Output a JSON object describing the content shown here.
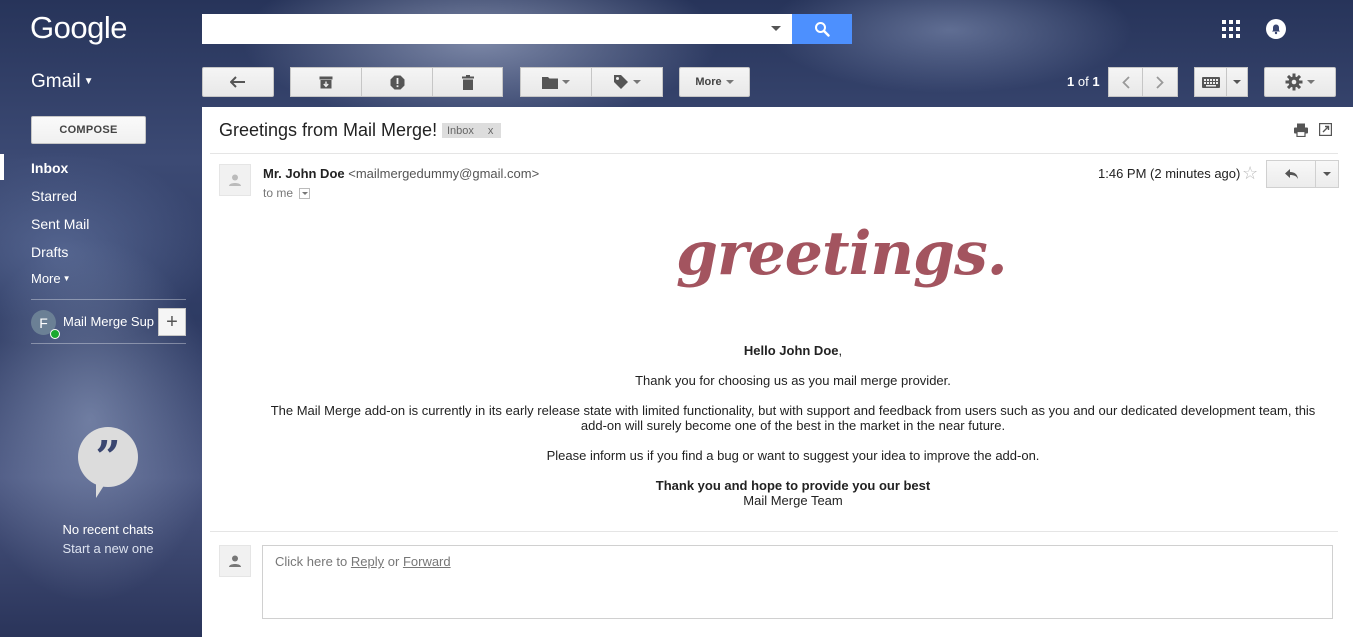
{
  "brand": {
    "logo_text": "Google",
    "app_name": "Gmail"
  },
  "search": {
    "value": "",
    "placeholder": ""
  },
  "toolbar": {
    "more_label": "More",
    "pager_current": "1",
    "pager_of": "of",
    "pager_total": "1",
    "icons": [
      "back-arrow-icon",
      "archive-icon",
      "report-spam-icon",
      "delete-icon",
      "folder-icon",
      "label-icon",
      "keyboard-icon",
      "settings-icon"
    ]
  },
  "sidebar": {
    "compose_label": "COMPOSE",
    "items": [
      {
        "label": "Inbox",
        "active": true
      },
      {
        "label": "Starred"
      },
      {
        "label": "Sent Mail"
      },
      {
        "label": "Drafts"
      },
      {
        "label": "More"
      }
    ],
    "hangouts": {
      "contact_initial": "F",
      "contact_name": "Mail Merge Sup",
      "empty_title": "No recent chats",
      "empty_action": "Start a new one"
    }
  },
  "email": {
    "subject": "Greetings from Mail Merge!",
    "label": "Inbox",
    "label_remove": "x",
    "sender_name": "Mr. John Doe",
    "sender_email": "<mailmergedummy@gmail.com>",
    "to": "to me",
    "timestamp": "1:46 PM (2 minutes ago)",
    "banner_text": "greetings.",
    "body": {
      "greeting_name": "Hello John Doe",
      "greeting_suffix": ",",
      "para1": "Thank you for choosing us as you mail merge provider.",
      "para2": "The Mail Merge add-on is currently in its early release state with limited functionality, but with support and feedback from users such as you and our dedicated development team, this add-on will surely become one of the best in the market in the near future.",
      "para3": "Please inform us if you find a bug or want to suggest your idea to improve the add-on.",
      "closing": "Thank you and hope to provide you our best",
      "signature": "Mail Merge Team"
    },
    "reply": {
      "prefix": "Click here to",
      "reply_link": "Reply",
      "or": "or",
      "forward_link": "Forward"
    }
  },
  "colors": {
    "search_button": "#4d90fe",
    "banner": "#a3545f",
    "presence": "#1ba82f"
  }
}
